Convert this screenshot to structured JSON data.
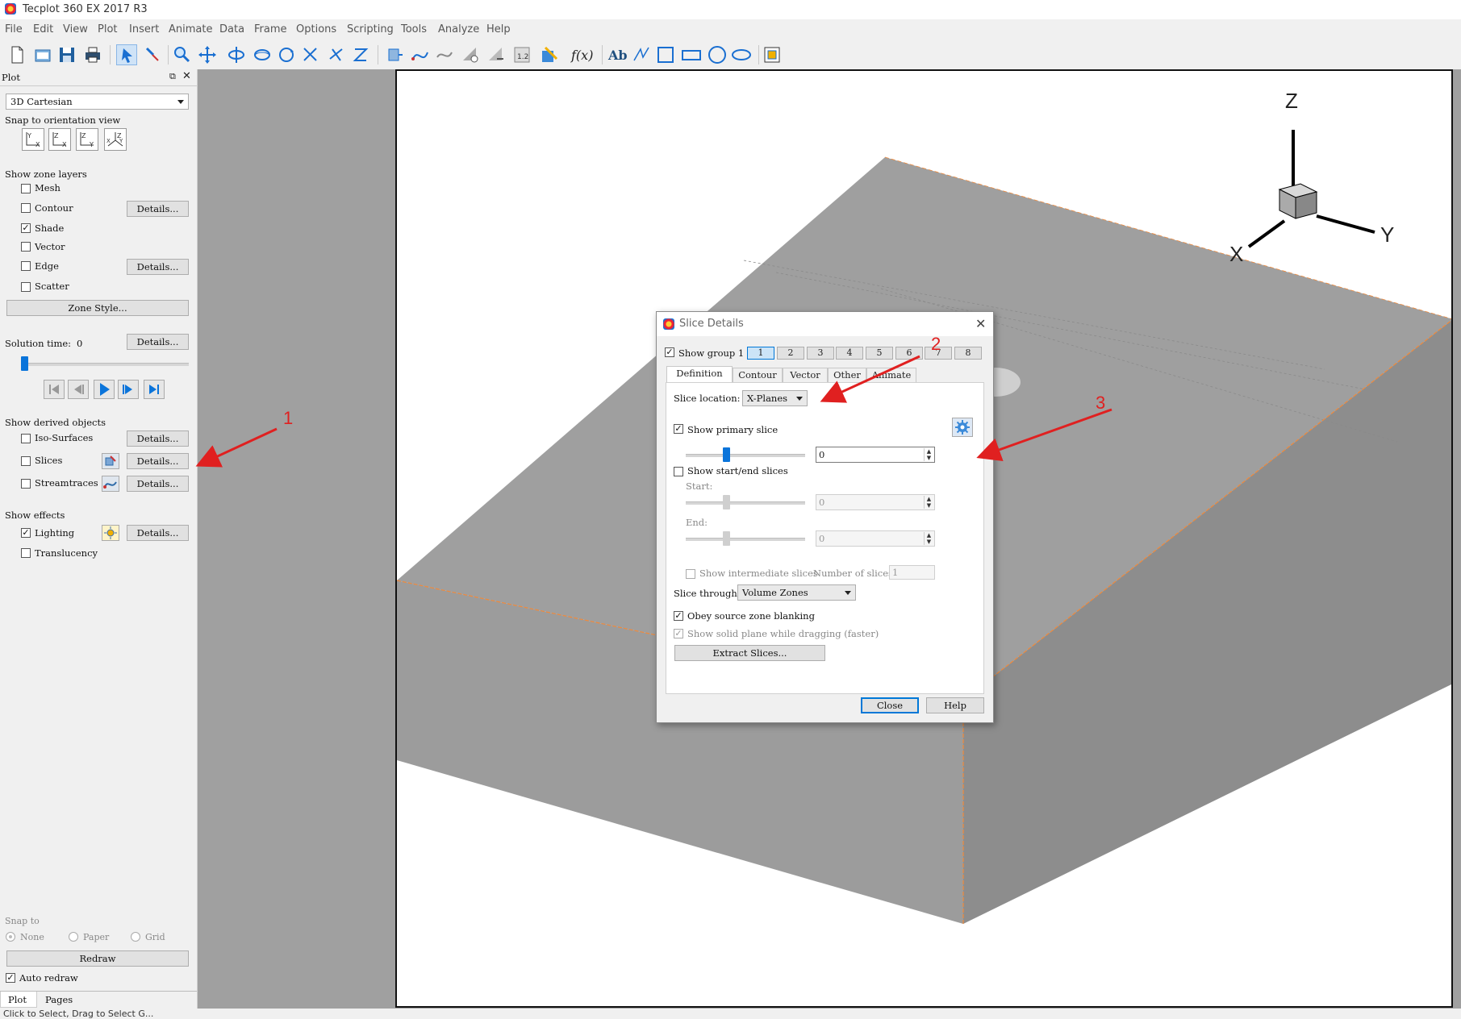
{
  "app": {
    "title": "Tecplot 360 EX 2017 R3"
  },
  "menu": [
    "File",
    "Edit",
    "View",
    "Plot",
    "Insert",
    "Animate",
    "Data",
    "Frame",
    "Options",
    "Scripting",
    "Tools",
    "Analyze",
    "Help"
  ],
  "sidebar": {
    "header": "Plot",
    "plot_type": "3D Cartesian",
    "snap_orientation_label": "Snap to orientation view",
    "orient_buttons": [
      "Y-X",
      "Z-X",
      "Z-Y",
      "XYZ"
    ],
    "zone_layers_label": "Show zone layers",
    "layers": [
      {
        "label": "Mesh",
        "checked": false
      },
      {
        "label": "Contour",
        "checked": false,
        "details": "Details..."
      },
      {
        "label": "Shade",
        "checked": true
      },
      {
        "label": "Vector",
        "checked": false
      },
      {
        "label": "Edge",
        "checked": false,
        "details": "Details..."
      },
      {
        "label": "Scatter",
        "checked": false
      }
    ],
    "zone_style": "Zone Style...",
    "solution_time_label": "Solution time:",
    "solution_time": "0",
    "solution_details": "Details...",
    "derived_label": "Show derived objects",
    "derived": [
      {
        "label": "Iso-Surfaces",
        "checked": false,
        "details": "Details..."
      },
      {
        "label": "Slices",
        "checked": false,
        "details": "Details..."
      },
      {
        "label": "Streamtraces",
        "checked": false,
        "details": "Details..."
      }
    ],
    "effects_label": "Show effects",
    "effects": [
      {
        "label": "Lighting",
        "checked": true,
        "details": "Details..."
      },
      {
        "label": "Translucency",
        "checked": false
      }
    ],
    "snap_to_label": "Snap to",
    "snap_options": [
      "None",
      "Paper",
      "Grid"
    ],
    "redraw": "Redraw",
    "auto_redraw": "Auto redraw",
    "tabs": [
      "Plot",
      "Pages"
    ]
  },
  "axes": {
    "z": "Z",
    "y": "Y",
    "x": "X"
  },
  "dialog": {
    "title": "Slice Details",
    "show_group": "Show group 1",
    "groups": [
      "1",
      "2",
      "3",
      "4",
      "5",
      "6",
      "7",
      "8"
    ],
    "tabs": [
      "Definition",
      "Contour",
      "Vector",
      "Other",
      "Animate"
    ],
    "slice_location_label": "Slice location:",
    "slice_location": "X-Planes",
    "show_primary": "Show primary slice",
    "primary_value": "0",
    "show_start_end": "Show start/end slices",
    "start_label": "Start:",
    "start_value": "0",
    "end_label": "End:",
    "end_value": "0",
    "show_intermediate": "Show intermediate slices",
    "num_slices_label": "Number of slices:",
    "num_slices": "1",
    "slice_through_label": "Slice through:",
    "slice_through": "Volume Zones",
    "obey_blanking": "Obey source zone blanking",
    "show_solid": "Show solid plane while dragging (faster)",
    "extract": "Extract Slices...",
    "close": "Close",
    "help": "Help"
  },
  "annotations": [
    "1",
    "2",
    "3"
  ],
  "status": {
    "text": "Click to Select, Drag to Select G..."
  },
  "colors": {
    "accent": "#0a74da",
    "annotation": "#e02020",
    "shade": "#9c9c9c"
  }
}
